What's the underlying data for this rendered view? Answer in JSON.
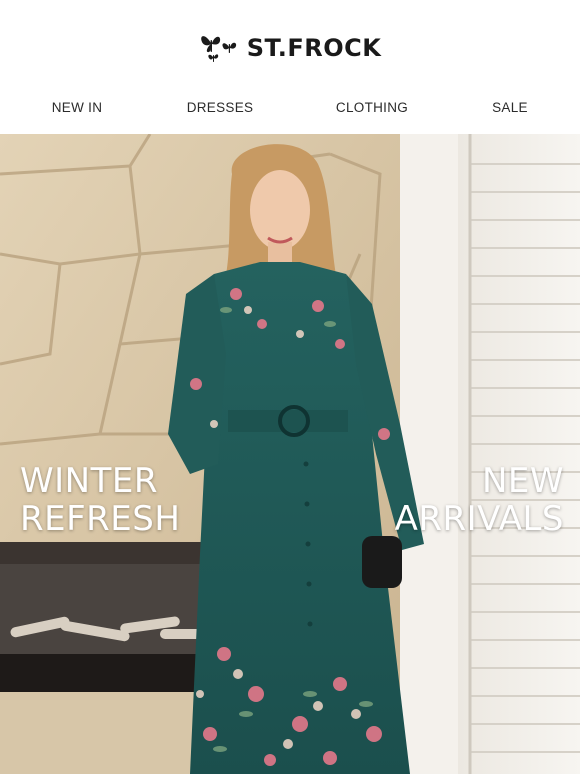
{
  "brand": {
    "name": "ST.FROCK",
    "logo_icon": "butterfly-icon"
  },
  "nav": {
    "items": [
      {
        "label": "NEW IN"
      },
      {
        "label": "DRESSES"
      },
      {
        "label": "CLOTHING"
      },
      {
        "label": "SALE"
      }
    ]
  },
  "hero": {
    "left_line1": "WINTER",
    "left_line2": "REFRESH",
    "right_line1": "NEW",
    "right_line2": "ARRIVALS",
    "colors": {
      "dress": "#1f5a5a",
      "stone_wall": "#d9c7a8",
      "shutter": "#f2efe9",
      "text": "#ffffff"
    }
  }
}
